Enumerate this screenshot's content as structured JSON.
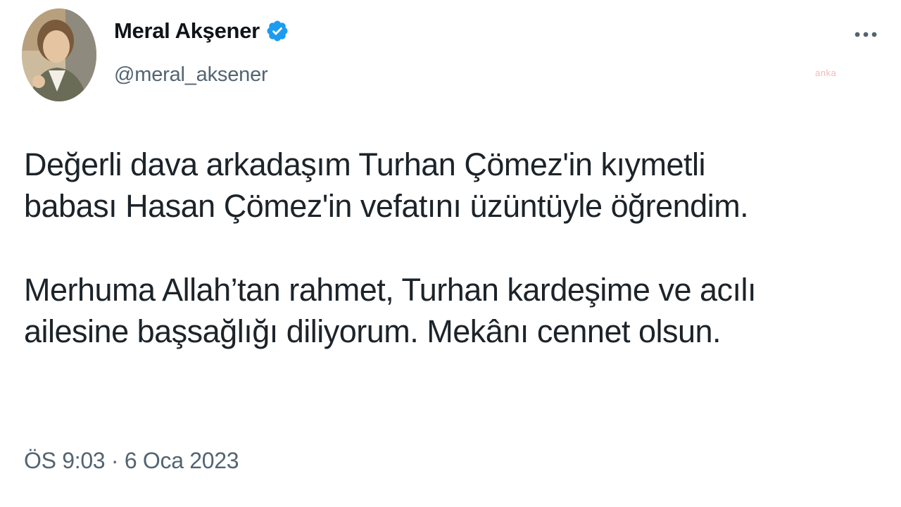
{
  "tweet": {
    "author": {
      "name": "Meral Akşener",
      "handle": "@meral_aksener",
      "verified": true,
      "avatar": "profile-photo"
    },
    "more_icon": "more-horizontal-icon",
    "watermark": "anka",
    "body": {
      "paragraph1": "Değerli dava arkadaşım Turhan Çömez'in kıymetli\nbabası Hasan Çömez'in vefatını üzüntüyle öğrendim.",
      "paragraph2": "Merhuma Allah’tan rahmet, Turhan kardeşime ve acılı\nailesine başsağlığı diliyorum. Mekânı cennet olsun."
    },
    "timestamp": "ÖS 9:03 · 6 Oca 2023"
  },
  "colors": {
    "verified": "#1d9bf0",
    "secondary_text": "#536471",
    "primary_text": "#0f1419",
    "watermark": "#f1a7a7"
  }
}
